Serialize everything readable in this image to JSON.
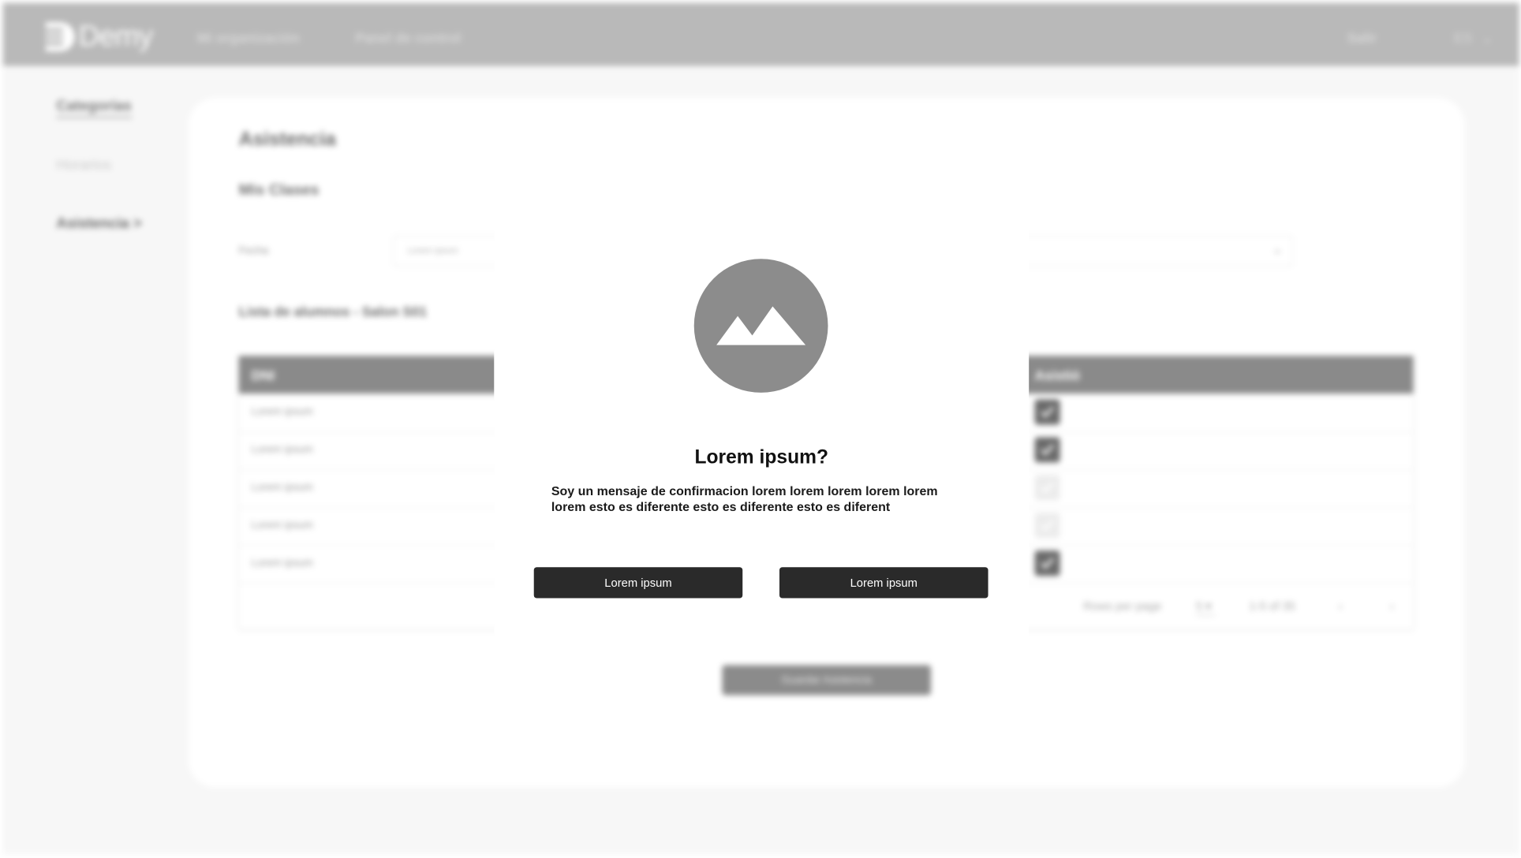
{
  "colors": {
    "topbar": "#b9b9b9",
    "table_header": "#8a8a8a",
    "checkbox_on": "#6a6a6a",
    "modal_button": "#2a2a2a",
    "modal_image": "#8c8c8c"
  },
  "header": {
    "brand": "Demy",
    "nav": [
      "Mi organización",
      "Panel de control"
    ],
    "logout": "Salir",
    "language": "ES"
  },
  "sidebar": {
    "items": [
      {
        "label": "Categorías"
      },
      {
        "label": "Horarios"
      },
      {
        "label": "Asistencia >"
      }
    ]
  },
  "main": {
    "title": "Asistencia",
    "subtitle": "Mis Clases",
    "date_label": "Fecha",
    "date_placeholder": "Lorem ipsum",
    "list_title": "Lista de alumnos - Salon S01",
    "table": {
      "headers": [
        "DNI",
        "Asistió"
      ],
      "rows": [
        {
          "dni": "Lorem ipsum",
          "attended": true
        },
        {
          "dni": "Lorem ipsum",
          "attended": true
        },
        {
          "dni": "Lorem ipsum",
          "attended": false
        },
        {
          "dni": "Lorem ipsum",
          "attended": false
        },
        {
          "dni": "Lorem ipsum",
          "attended": true
        }
      ],
      "rows_per_page_label": "Rows per page",
      "rows_per_page": "5",
      "range": "1-5 of 35"
    },
    "save_label": "Guardar Asistencia"
  },
  "modal": {
    "title": "Lorem ipsum?",
    "message": "Soy un mensaje de confirmacion lorem lorem lorem lorem lorem lorem esto es diferente esto es diferente esto es diferent",
    "buttons": [
      "Lorem ipsum",
      "Lorem ipsum"
    ],
    "image_icon": "image-placeholder-icon"
  }
}
